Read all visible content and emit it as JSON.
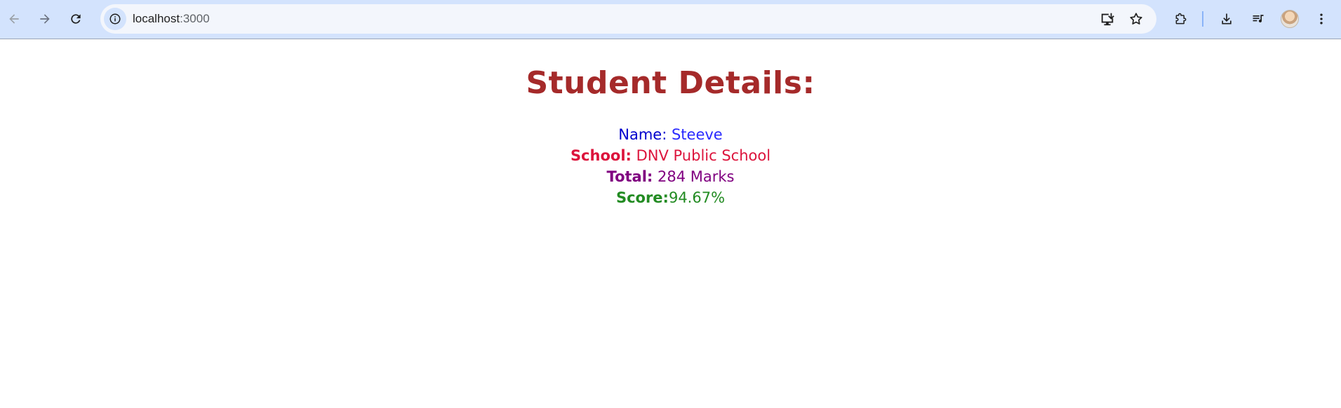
{
  "browser": {
    "url_host": "localhost",
    "url_port": ":3000",
    "icons": {
      "back": "back-arrow-icon",
      "forward": "forward-arrow-icon",
      "reload": "reload-icon",
      "site_info": "info-icon",
      "install": "install-app-icon",
      "bookmark": "star-icon",
      "extensions": "puzzle-icon",
      "downloads": "download-icon",
      "media": "media-queue-icon",
      "profile": "profile-avatar",
      "menu": "three-dots-menu-icon"
    },
    "colors": {
      "toolbar_bg": "#d3e3fd",
      "omnibox_bg": "#f3f6fc"
    }
  },
  "page": {
    "title": "Student Details:",
    "name": {
      "label": "Name:",
      "value": " Steeve"
    },
    "school": {
      "label": "School:",
      "value": " DNV Public School"
    },
    "total": {
      "label": "Total:",
      "value": " 284 Marks"
    },
    "score": {
      "label": "Score:",
      "value": "94.67%"
    },
    "colors": {
      "title": "#a52a2a",
      "name": "#0000ee",
      "school": "#dc143c",
      "total": "#800080",
      "score": "#228b22"
    }
  }
}
